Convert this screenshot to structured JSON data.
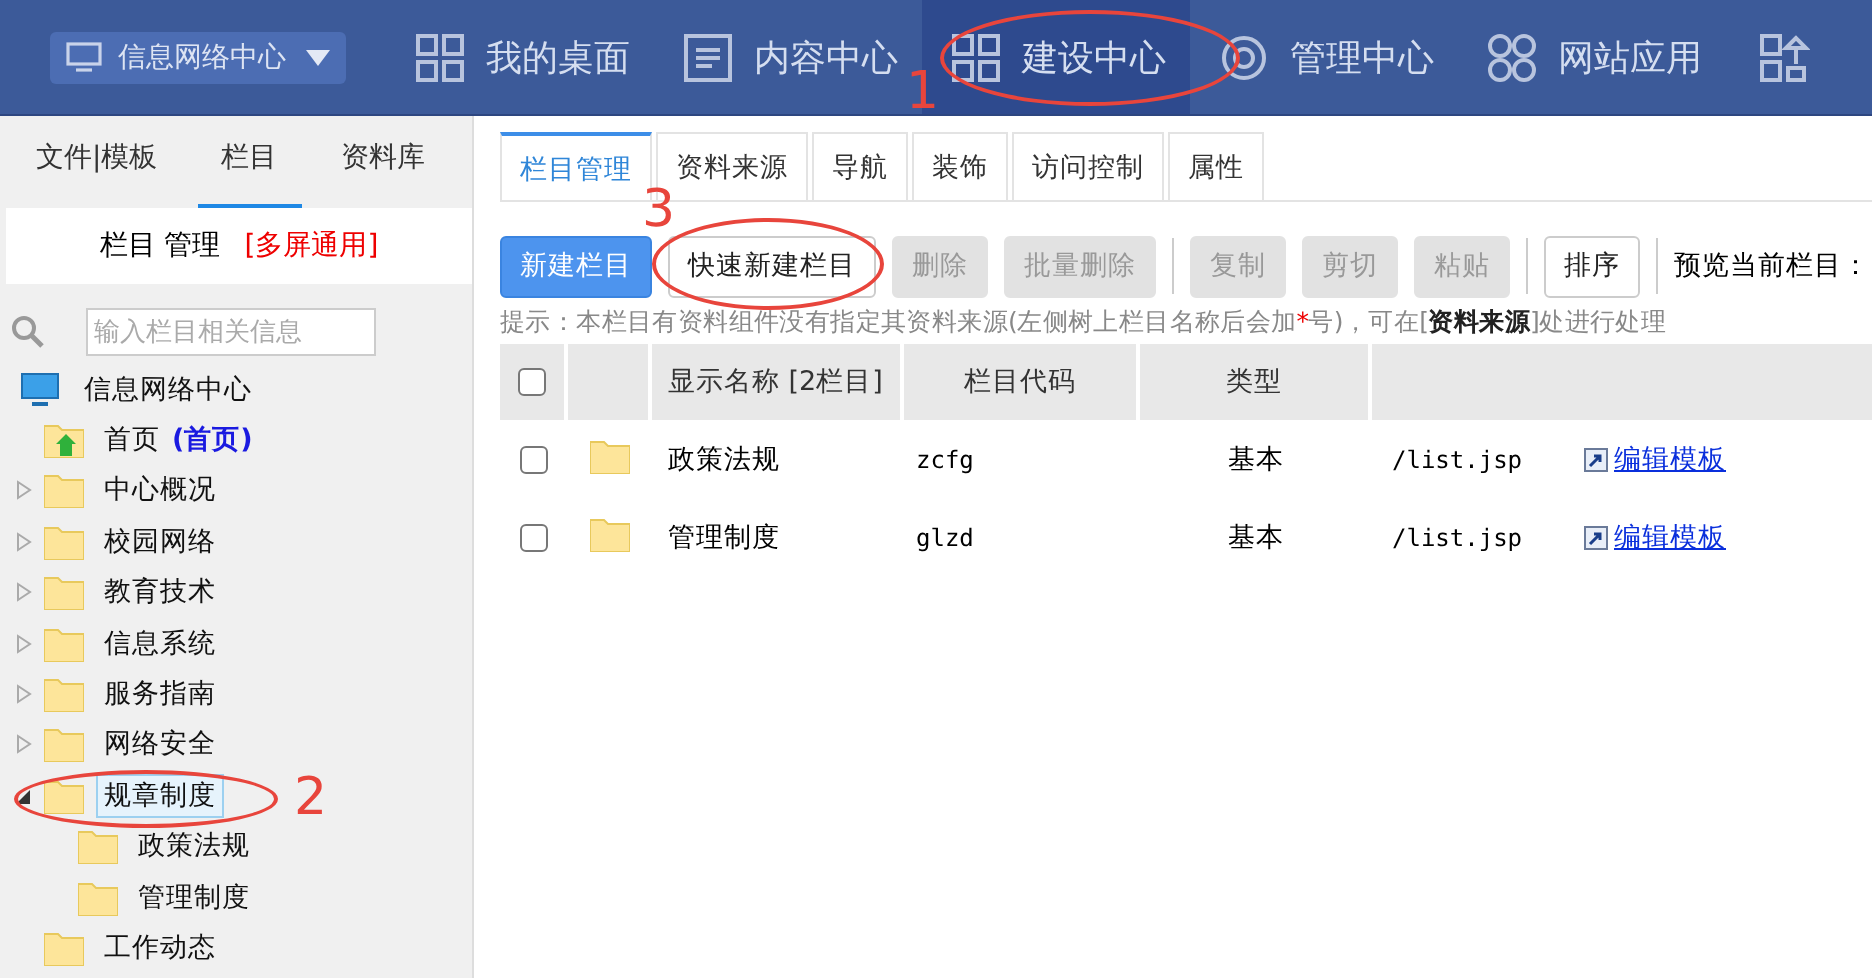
{
  "topbar": {
    "site": "信息网络中心",
    "nav": [
      {
        "label": "我的桌面",
        "selected": false
      },
      {
        "label": "内容中心",
        "selected": false
      },
      {
        "label": "建设中心",
        "selected": true
      },
      {
        "label": "管理中心",
        "selected": false
      },
      {
        "label": "网站应用",
        "selected": false
      }
    ]
  },
  "sidebar": {
    "tabs": [
      {
        "label": "文件|模板",
        "selected": false
      },
      {
        "label": "栏目",
        "selected": true
      },
      {
        "label": "资料库",
        "selected": false
      }
    ],
    "title": "栏目 管理",
    "title_tag": "[多屏通用]",
    "search": {
      "placeholder": "输入栏目相关信息"
    },
    "tree": {
      "label": "信息网络中心",
      "children": [
        {
          "kind": "home",
          "label": "首页",
          "tag": "(首页)",
          "selected": false
        },
        {
          "kind": "branch",
          "label": "中心概况",
          "expanded": false,
          "selected": false
        },
        {
          "kind": "branch",
          "label": "校园网络",
          "expanded": false,
          "selected": false
        },
        {
          "kind": "branch",
          "label": "教育技术",
          "expanded": false,
          "selected": false
        },
        {
          "kind": "branch",
          "label": "信息系统",
          "expanded": false,
          "selected": false
        },
        {
          "kind": "branch",
          "label": "服务指南",
          "expanded": false,
          "selected": false
        },
        {
          "kind": "branch",
          "label": "网络安全",
          "expanded": false,
          "selected": false
        },
        {
          "kind": "branch",
          "label": "规章制度",
          "expanded": true,
          "selected": true,
          "children": [
            {
              "kind": "leaf",
              "label": "政策法规",
              "selected": false
            },
            {
              "kind": "leaf",
              "label": "管理制度",
              "selected": false
            }
          ]
        },
        {
          "kind": "leaf",
          "label": "工作动态",
          "selected": false
        }
      ]
    }
  },
  "main": {
    "tabs": [
      {
        "label": "栏目管理",
        "selected": true
      },
      {
        "label": "资料来源",
        "selected": false
      },
      {
        "label": "导航",
        "selected": false
      },
      {
        "label": "装饰",
        "selected": false
      },
      {
        "label": "访问控制",
        "selected": false
      },
      {
        "label": "属性",
        "selected": false
      }
    ],
    "toolbar": [
      [
        {
          "label": "新建栏目",
          "kind": "primary",
          "disabled": false
        },
        {
          "label": "快速新建栏目",
          "kind": "normal",
          "disabled": false
        },
        {
          "label": "删除",
          "kind": "normal",
          "disabled": true
        },
        {
          "label": "批量删除",
          "kind": "normal",
          "disabled": true
        }
      ],
      [
        {
          "label": "复制",
          "kind": "normal",
          "disabled": true
        },
        {
          "label": "剪切",
          "kind": "normal",
          "disabled": true
        },
        {
          "label": "粘贴",
          "kind": "normal",
          "disabled": true
        }
      ],
      [
        {
          "label": "排序",
          "kind": "normal",
          "disabled": false
        }
      ]
    ],
    "preview_label": "预览当前栏目：",
    "hint": {
      "before": "提示：本栏目有资料组件没有指定其资料来源(左侧树上栏目名称后会加",
      "mark": "*",
      "after": "号)，可在[**资料来源**]处进行处理"
    },
    "table": {
      "columns": [
        "显示名称 [2栏目]",
        "栏目代码",
        "类型"
      ],
      "header_checked": false,
      "rows": [
        {
          "checked": false,
          "name": "政策法规",
          "code": "zcfg",
          "type": "基本",
          "template": "/list.jsp",
          "action": "编辑模板"
        },
        {
          "checked": false,
          "name": "管理制度",
          "code": "glzd",
          "type": "基本",
          "template": "/list.jsp",
          "action": "编辑模板"
        }
      ]
    }
  },
  "annotations": [
    {
      "label": "1"
    },
    {
      "label": "2"
    },
    {
      "label": "3"
    }
  ]
}
